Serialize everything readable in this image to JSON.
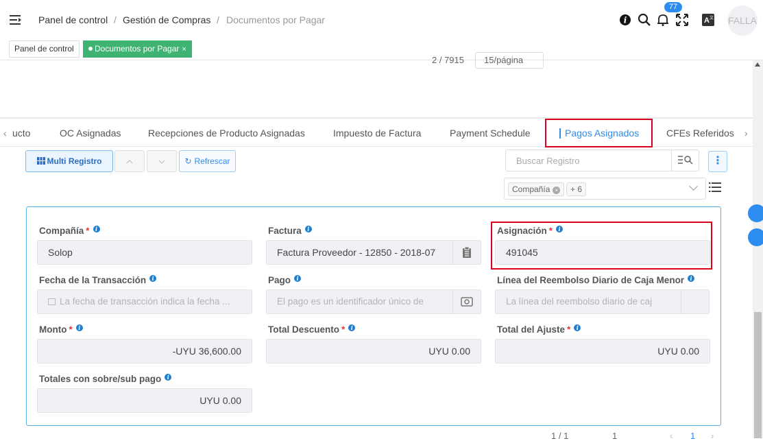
{
  "header": {
    "breadcrumb": [
      "Panel de control",
      "Gestión de Compras",
      "Documentos por Pagar"
    ],
    "notifications_count": "77",
    "avatar_text": "FALLA"
  },
  "page_tabs": [
    {
      "label": "Panel de control",
      "active": false
    },
    {
      "label": "Documentos por Pagar",
      "active": true,
      "close": "×"
    }
  ],
  "top_pagination": {
    "range": "2 / 7915",
    "per_page": "15/página"
  },
  "sub_tabs": [
    "ucto",
    "OC Asignadas",
    "Recepciones de Producto Asignadas",
    "Impuesto de Factura",
    "Payment Schedule",
    "Pagos Asignados",
    "CFEs Referidos"
  ],
  "active_sub_tab": "Pagos Asignados",
  "toolbar": {
    "multi_label": "Multi Registro",
    "refresh_label": "Refrescar",
    "search_placeholder": "Buscar Registro",
    "filter_tag": "Compañía",
    "filter_more": "+ 6"
  },
  "form": {
    "company": {
      "label": "Compañía",
      "value": "Solop"
    },
    "invoice": {
      "label": "Factura",
      "value": "Factura Proveedor - 12850 - 2018-07"
    },
    "allocation": {
      "label": "Asignación",
      "value": "491045"
    },
    "trx_date": {
      "label": "Fecha de la Transacción",
      "placeholder": "La fecha de transacción indica la fecha ..."
    },
    "payment": {
      "label": "Pago",
      "placeholder": "El pago es un identificador único de"
    },
    "cash_line": {
      "label": "Línea del Reembolso Diario de Caja Menor",
      "placeholder": "La línea del reembolso diario de caj"
    },
    "amount": {
      "label": "Monto",
      "value": "-UYU 36,600.00"
    },
    "discount": {
      "label": "Total Descuento",
      "value": "UYU 0.00"
    },
    "adjustment": {
      "label": "Total del Ajuste",
      "value": "UYU 0.00"
    },
    "over_under": {
      "label": "Totales con sobre/sub pago",
      "value": "UYU 0.00"
    }
  },
  "bottom_pagination": {
    "range": "1 / 1",
    "page_select": "1",
    "current": "1"
  }
}
